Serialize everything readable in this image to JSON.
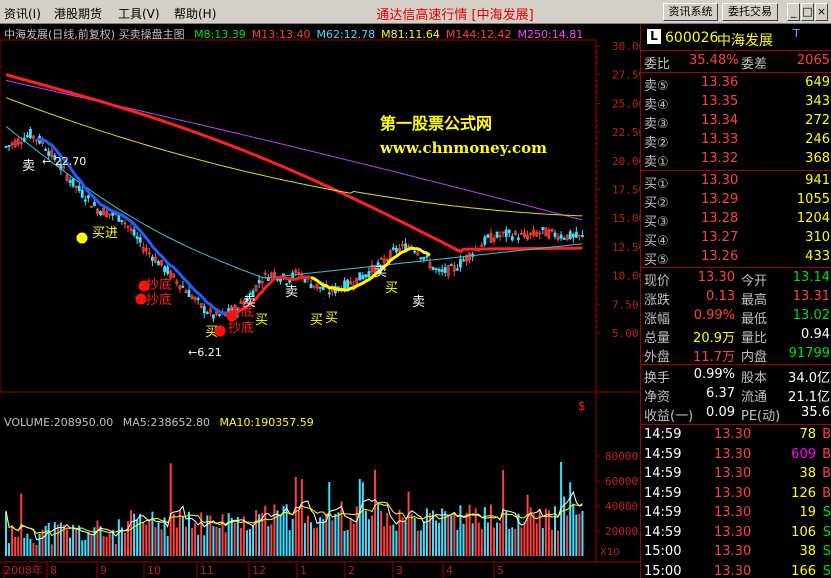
{
  "menu": {
    "items": [
      "资讯(I)",
      "港股期货",
      "工具(V)",
      "帮助(H)"
    ],
    "title": "通达信高速行情 [中海发展]",
    "buttons": [
      "资讯系统",
      "委托交易"
    ]
  },
  "chart": {
    "header_name": "中海发展(日线,前复权) 买卖操盘主图",
    "ma_labels": [
      {
        "text": "M8:13.39",
        "color": "#00e000"
      },
      {
        "text": "M13:13.40",
        "color": "#ff4040"
      },
      {
        "text": "M62:12.78",
        "color": "#40e0ff"
      },
      {
        "text": "M81:11.64",
        "color": "#ffff00"
      },
      {
        "text": "M144:12.42",
        "color": "#ff4040"
      },
      {
        "text": "M250:14.81",
        "color": "#ff40ff"
      }
    ],
    "price_ticks": [
      "30.00",
      "27.50",
      "25.00",
      "22.50",
      "20.00",
      "17.50",
      "15.00",
      "12.50",
      "10.00",
      "7.50",
      "5.00"
    ],
    "watermark_cn": "第一股票公式网",
    "watermark_url": "www.chnmoney.com",
    "high_label": "22.70",
    "low_label": "6.21",
    "annotations": [
      "卖",
      "买进",
      "抄底",
      "抄底",
      "抄底",
      "抄底",
      "买",
      "卖",
      "买",
      "卖",
      "卖",
      "买",
      "买",
      "卖",
      "买"
    ],
    "dollar_mark": "$",
    "volume_header": {
      "vol": "VOLUME:208950.00",
      "ma5": "MA5:238652.80",
      "ma10": "MA10:190357.59"
    },
    "volume_ticks": [
      "80000",
      "60000",
      "40000",
      "20000"
    ],
    "x10": "X10",
    "x_labels": [
      "2008年",
      "8",
      "9",
      "10",
      "11",
      "12",
      "1",
      "2",
      "3",
      "4",
      "5"
    ],
    "colors": {
      "grid": "#a00000",
      "ma144": "#ff2020",
      "ma250": "#c040ff",
      "ma81": "#e0e000",
      "ma62": "#40c0d0",
      "up": "#ff4040",
      "down": "#40e0ff"
    }
  },
  "quote": {
    "code": "600026",
    "name": "中海发展",
    "t": "T",
    "l_icon": "L",
    "weibi_label": "委比",
    "weibi": "35.48%",
    "weicha_label": "委差",
    "weicha": "2065",
    "sell": [
      {
        "label": "卖⑤",
        "price": "13.36",
        "vol": "649"
      },
      {
        "label": "卖④",
        "price": "13.35",
        "vol": "343"
      },
      {
        "label": "卖③",
        "price": "13.34",
        "vol": "272"
      },
      {
        "label": "卖②",
        "price": "13.33",
        "vol": "246"
      },
      {
        "label": "卖①",
        "price": "13.32",
        "vol": "368"
      }
    ],
    "buy": [
      {
        "label": "买①",
        "price": "13.30",
        "vol": "941"
      },
      {
        "label": "买②",
        "price": "13.29",
        "vol": "1055"
      },
      {
        "label": "买③",
        "price": "13.28",
        "vol": "1204"
      },
      {
        "label": "买④",
        "price": "13.27",
        "vol": "310"
      },
      {
        "label": "买⑤",
        "price": "13.26",
        "vol": "433"
      }
    ],
    "stats": [
      {
        "l1": "现价",
        "v1": "13.30",
        "c1": "red",
        "l2": "今开",
        "v2": "13.14",
        "c2": "grn"
      },
      {
        "l1": "涨跌",
        "v1": "0.13",
        "c1": "red",
        "l2": "最高",
        "v2": "13.31",
        "c2": "red"
      },
      {
        "l1": "涨幅",
        "v1": "0.99%",
        "c1": "red",
        "l2": "最低",
        "v2": "13.02",
        "c2": "grn"
      },
      {
        "l1": "总量",
        "v1": "20.9万",
        "c1": "yel",
        "l2": "量比",
        "v2": "0.94",
        "c2": "wht"
      },
      {
        "l1": "外盘",
        "v1": "11.7万",
        "c1": "red",
        "l2": "内盘",
        "v2": "91799",
        "c2": "grn"
      }
    ],
    "fund": [
      {
        "l1": "换手",
        "v1": "0.99%",
        "l2": "股本",
        "v2": "34.0亿"
      },
      {
        "l1": "净资",
        "v1": "6.37",
        "l2": "流通",
        "v2": "21.1亿"
      },
      {
        "l1": "收益(一)",
        "v1": "0.09",
        "l2": "PE(动)",
        "v2": "35.6"
      }
    ],
    "ticks": [
      {
        "time": "14:59",
        "price": "13.30",
        "vol": "78",
        "vc": "yel",
        "bs": "B",
        "bc": "red"
      },
      {
        "time": "14:59",
        "price": "13.30",
        "vol": "609",
        "vc": "mag",
        "bs": "B",
        "bc": "red"
      },
      {
        "time": "14:59",
        "price": "13.30",
        "vol": "38",
        "vc": "yel",
        "bs": "B",
        "bc": "red"
      },
      {
        "time": "14:59",
        "price": "13.30",
        "vol": "126",
        "vc": "yel",
        "bs": "B",
        "bc": "red"
      },
      {
        "time": "14:59",
        "price": "13.30",
        "vol": "19",
        "vc": "yel",
        "bs": "S",
        "bc": "grn"
      },
      {
        "time": "14:59",
        "price": "13.30",
        "vol": "106",
        "vc": "yel",
        "bs": "S",
        "bc": "grn"
      },
      {
        "time": "15:00",
        "price": "13.30",
        "vol": "38",
        "vc": "yel",
        "bs": "S",
        "bc": "grn"
      },
      {
        "time": "15:00",
        "price": "13.30",
        "vol": "166",
        "vc": "yel",
        "bs": "S",
        "bc": "grn"
      }
    ]
  }
}
